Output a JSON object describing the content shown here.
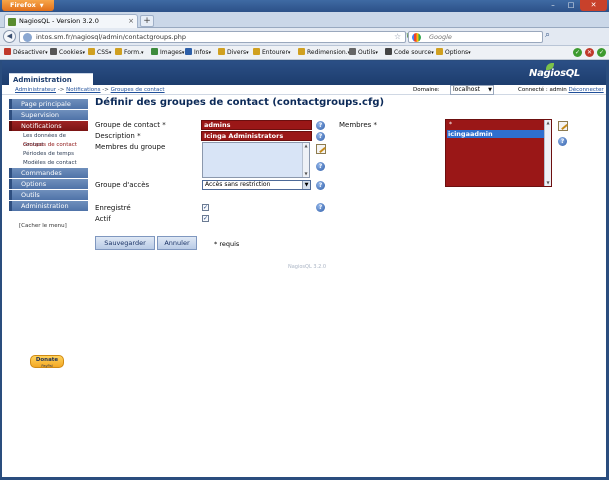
{
  "browser": {
    "menu_button": "Firefox",
    "tab_title": "NagiosQL - Version 3.2.0",
    "new_tab": "+",
    "url": "intos.sm.fr/nagiosql/admin/contactgroups.php",
    "search_placeholder": "Google",
    "toolbar": [
      {
        "label": "Désactiver",
        "icon": "no-entry-icon",
        "color": "#c0392b"
      },
      {
        "label": "Cookies",
        "icon": "person-icon",
        "color": "#555555"
      },
      {
        "label": "CSS",
        "icon": "pencil-icon",
        "color": "#d0a020"
      },
      {
        "label": "Form.",
        "icon": "form-icon",
        "color": "#d0a020"
      },
      {
        "label": "Images",
        "icon": "image-icon",
        "color": "#3d8b3d"
      },
      {
        "label": "Infos",
        "icon": "info-icon",
        "color": "#2d5fa8"
      },
      {
        "label": "Divers",
        "icon": "folder-icon",
        "color": "#d0a020"
      },
      {
        "label": "Entourer",
        "icon": "pencil-icon",
        "color": "#d0a020"
      },
      {
        "label": "Redimension.",
        "icon": "resize-icon",
        "color": "#d0a020"
      },
      {
        "label": "Outils",
        "icon": "tools-icon",
        "color": "#666666"
      },
      {
        "label": "Code source",
        "icon": "source-icon",
        "color": "#444444"
      },
      {
        "label": "Options",
        "icon": "options-icon",
        "color": "#d0a020"
      }
    ]
  },
  "app": {
    "section_tab": "Administration",
    "logo_text": "NagiosQL",
    "breadcrumb": [
      "Administrateur",
      "Notifications",
      "Groupes de contact"
    ],
    "breadcrumb_sep": "->",
    "domain_label": "Domaine:",
    "domain_value": "localhost",
    "connected_label": "Connecté : admin",
    "logout_link": "Déconnecter"
  },
  "sidebar": {
    "items": [
      {
        "label": "Page principale",
        "active": false
      },
      {
        "label": "Supervision",
        "active": false
      },
      {
        "label": "Notifications",
        "active": true
      },
      {
        "label": "Commandes",
        "active": false
      },
      {
        "label": "Options",
        "active": false
      },
      {
        "label": "Outils",
        "active": false
      },
      {
        "label": "Administration",
        "active": false
      }
    ],
    "subitems": [
      "Les données de contact",
      "Groupes de contact",
      "Périodes de temps",
      "Modèles de contact"
    ],
    "hide_menu": "[Cacher le menu]",
    "donate_label": "Donate",
    "donate_sub": "PayPal"
  },
  "form": {
    "title": "Définir des groupes de contact (contactgroups.cfg)",
    "group_label": "Groupe de contact *",
    "group_value": "admins",
    "description_label": "Description *",
    "description_value": "Icinga Administrators",
    "members_group_label": "Membres du groupe",
    "access_label": "Groupe d'accès",
    "access_value": "Accès sans restriction",
    "registered_label": "Enregistré",
    "active_label": "Actif",
    "members_label": "Membres *",
    "members_first": "*",
    "members_selected": "icingaadmin",
    "save_button": "Sauvegarder",
    "cancel_button": "Annuler",
    "required_note": "* requis",
    "version": "NagiosQL 3.2.0"
  }
}
